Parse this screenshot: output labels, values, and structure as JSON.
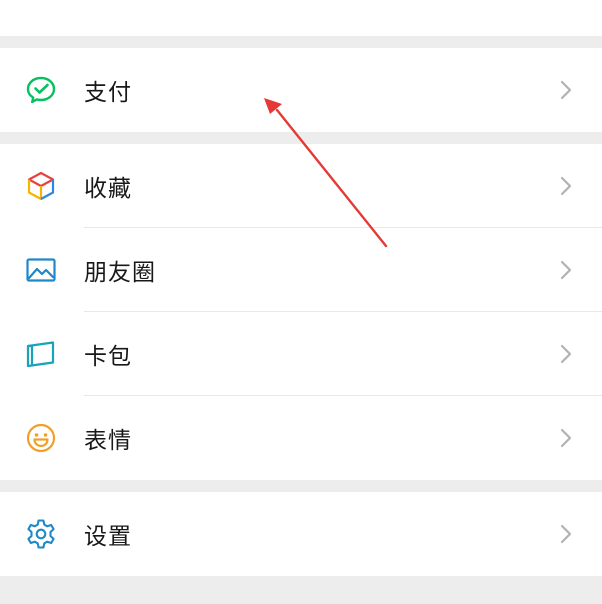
{
  "menu": {
    "pay": {
      "label": "支付",
      "icon": "wechat-pay-icon"
    },
    "favorites": {
      "label": "收藏",
      "icon": "cube-icon"
    },
    "moments": {
      "label": "朋友圈",
      "icon": "picture-icon"
    },
    "cards": {
      "label": "卡包",
      "icon": "card-icon"
    },
    "stickers": {
      "label": "表情",
      "icon": "smiley-icon"
    },
    "settings": {
      "label": "设置",
      "icon": "gear-icon"
    }
  },
  "colors": {
    "background": "#ededed",
    "row_background": "#ffffff",
    "text": "#181818",
    "chevron": "#b2b2b2",
    "pay_green": "#07c160",
    "annotation_red": "#e53935"
  }
}
